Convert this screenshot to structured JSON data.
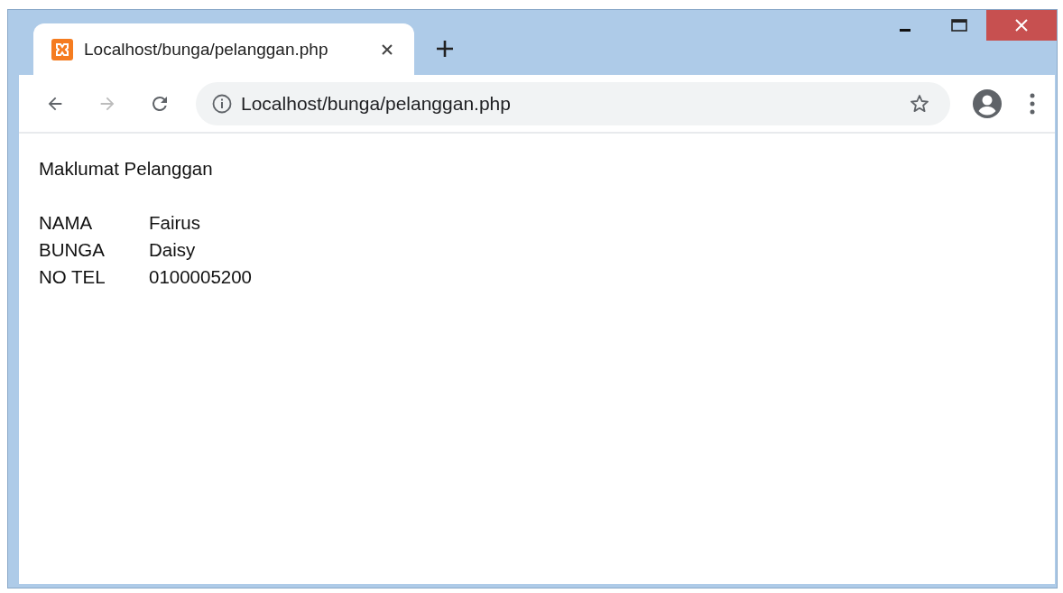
{
  "tabs": [
    {
      "title": "Localhost/bunga/pelanggan.php",
      "selected": true
    }
  ],
  "nav_buttons": [
    {
      "kind": "back",
      "disabled": false
    },
    {
      "kind": "forward",
      "disabled": true
    },
    {
      "kind": "reload",
      "disabled": false
    }
  ],
  "address_bar": {
    "value": "Localhost/bunga/pelanggan.php"
  },
  "page": {
    "heading": "Maklumat Pelanggan",
    "rows": [
      {
        "label": "NAMA",
        "value": "Fairus"
      },
      {
        "label": "BUNGA",
        "value": "Daisy"
      },
      {
        "label": "NO TEL",
        "value": "0100005200"
      }
    ]
  }
}
